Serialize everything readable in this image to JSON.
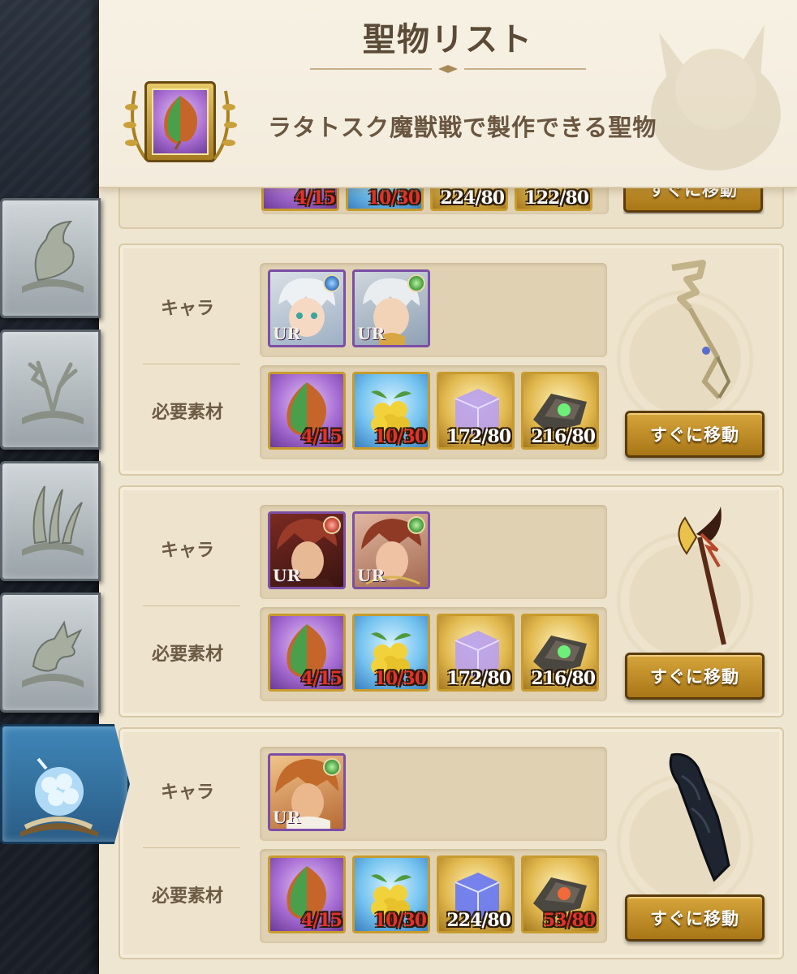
{
  "header": {
    "title": "聖物リスト",
    "subtitle": "ラタトスク魔獣戦で製作できる聖物"
  },
  "labels": {
    "chara": "キャラ",
    "materials": "必要素材",
    "move_button": "すぐに移動"
  },
  "sidebar": {
    "tabs": [
      {
        "icon": "fox-emblem-icon",
        "active": false
      },
      {
        "icon": "antler-emblem-icon",
        "active": false
      },
      {
        "icon": "claw-emblem-icon",
        "active": false
      },
      {
        "icon": "dragon-emblem-icon",
        "active": false
      },
      {
        "icon": "glowing-fruit-icon",
        "active": true
      }
    ]
  },
  "top_partial": {
    "counts": [
      "4/15",
      "10/30",
      "224/80",
      "122/80"
    ],
    "button": "すぐに移動"
  },
  "cards": [
    {
      "weapon_icon": "staff-weapon-icon",
      "characters": [
        {
          "rarity": "UR",
          "attribute": "blue"
        },
        {
          "rarity": "UR",
          "attribute": "green"
        }
      ],
      "materials": [
        {
          "icon": "leaf-material-icon",
          "count": "4/15",
          "insufficient": true
        },
        {
          "icon": "golden-fruit-icon",
          "count": "10/30",
          "insufficient": true
        },
        {
          "icon": "purple-cube-icon",
          "count": "172/80",
          "insufficient": false
        },
        {
          "icon": "green-gem-shard-icon",
          "count": "216/80",
          "insufficient": false
        }
      ],
      "button": "すぐに移動"
    },
    {
      "weapon_icon": "axe-spear-weapon-icon",
      "characters": [
        {
          "rarity": "UR",
          "attribute": "red"
        },
        {
          "rarity": "UR",
          "attribute": "green"
        }
      ],
      "materials": [
        {
          "icon": "leaf-material-icon",
          "count": "4/15",
          "insufficient": true
        },
        {
          "icon": "golden-fruit-icon",
          "count": "10/30",
          "insufficient": true
        },
        {
          "icon": "purple-cube-icon",
          "count": "172/80",
          "insufficient": false
        },
        {
          "icon": "green-gem-shard-icon",
          "count": "216/80",
          "insufficient": false
        }
      ],
      "button": "すぐに移動"
    },
    {
      "weapon_icon": "gauntlet-weapon-icon",
      "characters": [
        {
          "rarity": "UR",
          "attribute": "green"
        }
      ],
      "materials": [
        {
          "icon": "leaf-material-icon",
          "count": "4/15",
          "insufficient": true
        },
        {
          "icon": "golden-fruit-icon",
          "count": "10/30",
          "insufficient": true
        },
        {
          "icon": "blue-cube-icon",
          "count": "224/80",
          "insufficient": false
        },
        {
          "icon": "red-gem-shard-icon",
          "count": "53/80",
          "insufficient": true
        }
      ],
      "button": "すぐに移動"
    }
  ],
  "colors": {
    "parchment": "#efe6d2",
    "button_gold": "#c8951f",
    "insufficient_red": "#e4312b",
    "active_tab_blue": "#3f86b8"
  }
}
